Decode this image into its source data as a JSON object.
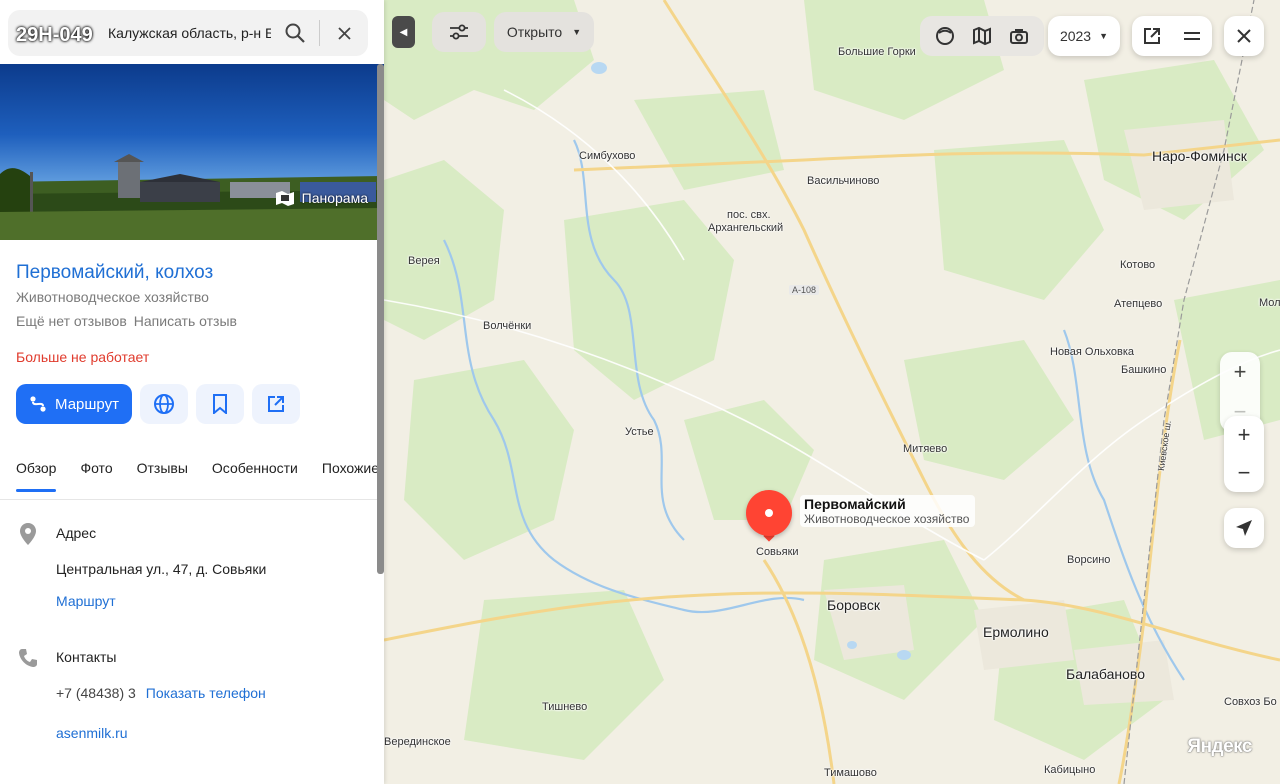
{
  "search": {
    "query": "Калужская область, р-н Боровск"
  },
  "watermark": "29H-049",
  "photo": {
    "panorama_label": "Панорама"
  },
  "org": {
    "name": "Первомайский, колхоз",
    "category": "Животноводческое хозяйство",
    "no_reviews": "Ещё нет отзывов",
    "write_review": "Написать отзыв",
    "status": "Больше не работает"
  },
  "actions": {
    "route": "Маршрут"
  },
  "tabs": [
    "Обзор",
    "Фото",
    "Отзывы",
    "Особенности",
    "Похожие"
  ],
  "address": {
    "heading": "Адрес",
    "value": "Центральная ул., 47, д. Совьяки",
    "route_link": "Маршрут"
  },
  "contacts": {
    "heading": "Контакты",
    "phone_partial": "+7 (48438) 3",
    "show_phone": "Показать телефон",
    "site": "asenmilk.ru"
  },
  "map_toolbar": {
    "filter_label": "Открыто",
    "year": "2023"
  },
  "map_labels": [
    "Большие Горки",
    "Симбухово",
    "Васильчиново",
    "Наро-Фоминск",
    "пос. свх.",
    "Архангельский",
    "Верея",
    "А-108",
    "Котово",
    "Атепцево",
    "Мол",
    "Волчёнки",
    "Новая Ольховка",
    "Башкино",
    "Устье",
    "Митяево",
    "Киевское ш.",
    "Совьяки",
    "Ворсино",
    "Боровск",
    "Ермолино",
    "Балабаново",
    "Совхоз Бо",
    "Тишнево",
    "Верединское",
    "Тимашово",
    "Кабицыно"
  ],
  "pin": {
    "title": "Первомайский",
    "subtitle": "Животноводческое хозяйство"
  },
  "brand": "Яндекс"
}
